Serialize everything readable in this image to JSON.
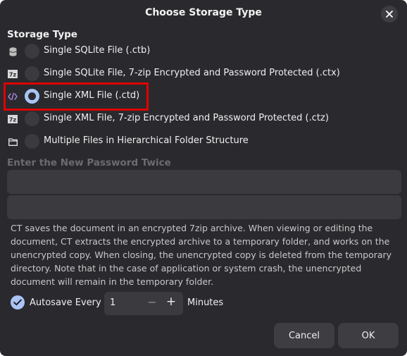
{
  "dialog": {
    "title": "Choose Storage Type",
    "close_icon": "close-icon"
  },
  "storage": {
    "label": "Storage Type",
    "options": [
      {
        "label": "Single SQLite File (.ctb)",
        "icon": "database-icon",
        "checked": false
      },
      {
        "label": "Single SQLite File, 7-zip Encrypted and Password Protected (.ctx)",
        "icon": "7zip-icon",
        "checked": false
      },
      {
        "label": "Single XML File (.ctd)",
        "icon": "code-icon",
        "checked": true
      },
      {
        "label": "Single XML File, 7-zip Encrypted and Password Protected (.ctz)",
        "icon": "7zip-icon",
        "checked": false
      },
      {
        "label": "Multiple Files in Hierarchical Folder Structure",
        "icon": "folder-icon",
        "checked": false
      }
    ]
  },
  "password": {
    "label": "Enter the New Password Twice",
    "field1_value": "",
    "field2_value": ""
  },
  "description": "CT saves the document in an encrypted 7zip archive. When viewing or editing the document, CT extracts the encrypted archive to a temporary folder, and works on the unencrypted copy. When closing, the unencrypted copy is deleted from the temporary directory. Note that in the case of application or system crash, the unencrypted document will remain in the temporary folder.",
  "autosave": {
    "checked": true,
    "label": "Autosave Every",
    "value": "1",
    "minus": "−",
    "plus": "+",
    "unit": "Minutes"
  },
  "buttons": {
    "cancel": "Cancel",
    "ok": "OK"
  },
  "colors": {
    "dialog_bg": "#2a2a2e",
    "accent": "#a9c4f5",
    "highlight": "#e00000",
    "code_icon": "#b08ee8"
  }
}
